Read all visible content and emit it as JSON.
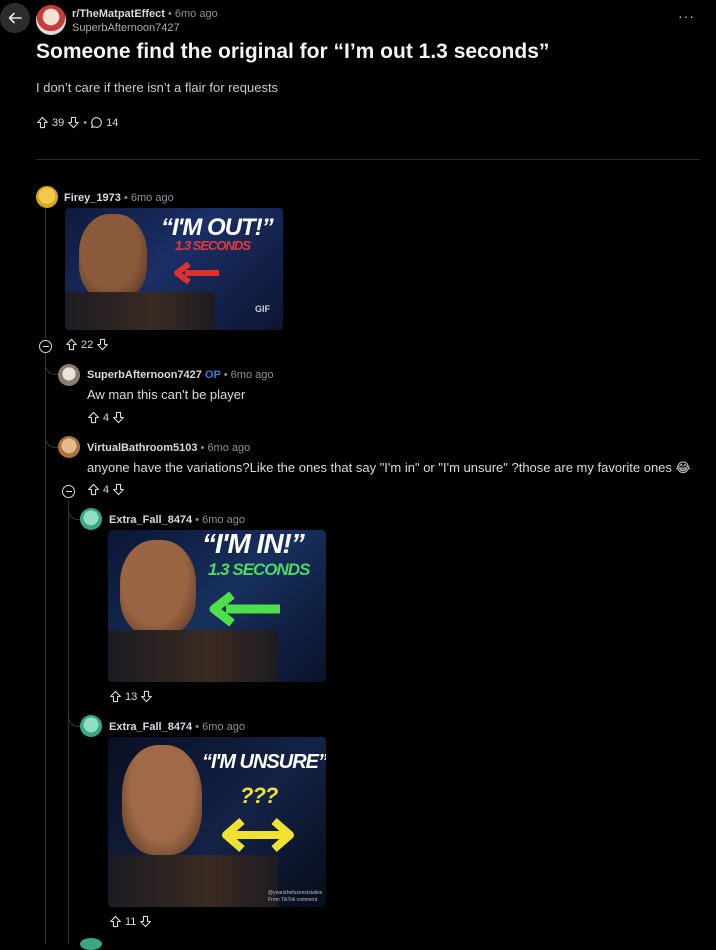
{
  "post": {
    "subreddit": "r/TheMatpatEffect",
    "sep": "•",
    "time": "6mo ago",
    "author": "SuperbAfternoon7427",
    "title": "Someone find the original for “I’m out 1.3 seconds”",
    "body": "I don’t care if there isn’t a flair for requests",
    "upvotes": "39",
    "comments": "14",
    "more": "···"
  },
  "comments": [
    {
      "author": "Firey_1973",
      "time": "6mo ago",
      "gif": {
        "caption": "“I'M OUT!”",
        "sub": "1.3 SECONDS",
        "badge": "GIF"
      },
      "votes": "22"
    },
    {
      "author": "SuperbAfternoon7427",
      "op": "OP",
      "time": "6mo ago",
      "text": "Aw man this can't be player",
      "votes": "4"
    },
    {
      "author": "VirtualBathroom5103",
      "time": "6mo ago",
      "text": "anyone have the variations?Like the ones that say \"I'm in\" or \"I'm unsure\" ?those are my favorite ones 😂",
      "votes": "4"
    },
    {
      "author": "Extra_Fall_8474",
      "time": "6mo ago",
      "gif": {
        "caption": "“I'M IN!”",
        "sub": "1.3 SECONDS"
      },
      "votes": "13"
    },
    {
      "author": "Extra_Fall_8474",
      "time": "6mo ago",
      "gif": {
        "caption": "“I'M UNSURE”",
        "sub": "???",
        "watermark": "@yearsthefuzeexistalive",
        "watermark2": "From TikTok comment"
      },
      "votes": "11"
    }
  ],
  "colors": {
    "bg": "#000000",
    "text": "#d7dadc",
    "meta": "#8e9194",
    "op": "#3a7bd5",
    "line": "#343536"
  },
  "icons": [
    "back-arrow-icon",
    "upvote-icon",
    "downvote-icon",
    "comment-icon",
    "collapse-icon",
    "more-options-icon"
  ]
}
